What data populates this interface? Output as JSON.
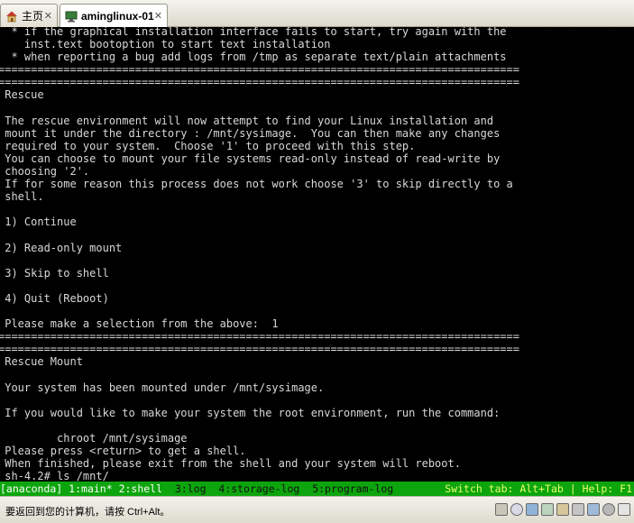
{
  "tabs": [
    {
      "label": "主页",
      "icon": "home-icon",
      "close": "✕"
    },
    {
      "label": "aminglinux-01",
      "icon": "vm-icon",
      "close": "✕"
    }
  ],
  "terminal": {
    "lines": [
      "  * if the graphical installation interface fails to start, try again with the",
      "    inst.text bootoption to start text installation",
      "  * when reporting a bug add logs from /tmp as separate text/plain attachments",
      "================================================================================",
      "================================================================================",
      " Rescue",
      "",
      " The rescue environment will now attempt to find your Linux installation and",
      " mount it under the directory : /mnt/sysimage.  You can then make any changes",
      " required to your system.  Choose '1' to proceed with this step.",
      " You can choose to mount your file systems read-only instead of read-write by",
      " choosing '2'.",
      " If for some reason this process does not work choose '3' to skip directly to a",
      " shell.",
      "",
      " 1) Continue",
      "",
      " 2) Read-only mount",
      "",
      " 3) Skip to shell",
      "",
      " 4) Quit (Reboot)",
      "",
      " Please make a selection from the above:  1",
      "================================================================================",
      "================================================================================",
      " Rescue Mount",
      "",
      " Your system has been mounted under /mnt/sysimage.",
      "",
      " If you would like to make your system the root environment, run the command:",
      "",
      "         chroot /mnt/sysimage",
      " Please press <return> to get a shell.",
      " When finished, please exit from the shell and your system will reboot.",
      " sh-4.2# ls /mnt/_"
    ]
  },
  "tmux_status": {
    "session": "[anaconda]",
    "window_1": " 1:main*",
    "window_2": " 2:shell",
    "window_3": "  3:log",
    "window_4": "  4:storage-log",
    "window_5": "  5:program-log",
    "help": "Switch tab: Alt+Tab | Help: F1"
  },
  "vm_status": {
    "message": "要返回到您的计算机，请按 Ctrl+Alt。",
    "tray_icons": [
      "hdd-icon",
      "cdrom-icon",
      "network-icon",
      "usb-icon",
      "sound-icon",
      "printer-icon",
      "display-icon",
      "settings-icon",
      "fullscreen-icon"
    ]
  },
  "colors": {
    "terminal_bg": "#000000",
    "terminal_fg": "#d8d8d8",
    "status_green": "#0da50d",
    "status_help": "#e6ff6a"
  }
}
